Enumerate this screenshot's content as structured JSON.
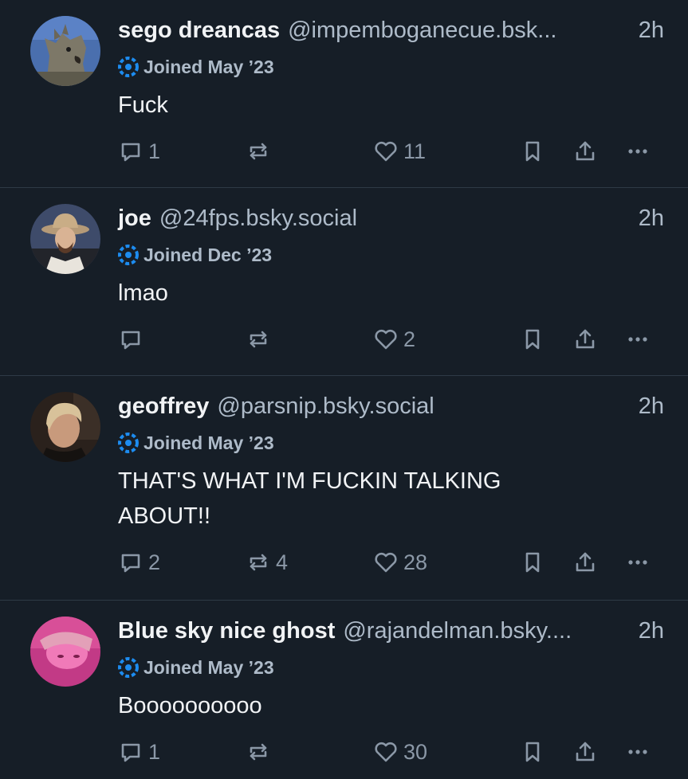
{
  "colors": {
    "background": "#161e27",
    "divider": "#2e3a46",
    "muted": "#aebbc9",
    "icon": "#8b98a7",
    "badge": "#1d8cf0"
  },
  "posts": [
    {
      "name": "sego dreancas",
      "handle": "@impemboganecue.bsk...",
      "time": "2h",
      "joined": "Joined May ’23",
      "text": "Fuck",
      "replies": "1",
      "reposts": "",
      "likes": "11",
      "avatar_icon": "wolf-avatar"
    },
    {
      "name": "joe",
      "handle": "@24fps.bsky.social",
      "time": "2h",
      "joined": "Joined Dec ’23",
      "text": "lmao",
      "replies": "",
      "reposts": "",
      "likes": "2",
      "avatar_icon": "cowboy-hat-avatar"
    },
    {
      "name": "geoffrey",
      "handle": "@parsnip.bsky.social",
      "time": "2h",
      "joined": "Joined May ’23",
      "text": "THAT'S WHAT I'M FUCKIN TALKING ABOUT!!",
      "replies": "2",
      "reposts": "4",
      "likes": "28",
      "avatar_icon": "person-photo-avatar"
    },
    {
      "name": "Blue sky nice ghost",
      "handle": "@rajandelman.bsky....",
      "time": "2h",
      "joined": "Joined May ’23",
      "text": "Boooooooooo",
      "replies": "1",
      "reposts": "",
      "likes": "30",
      "avatar_icon": "pink-photo-avatar"
    }
  ]
}
